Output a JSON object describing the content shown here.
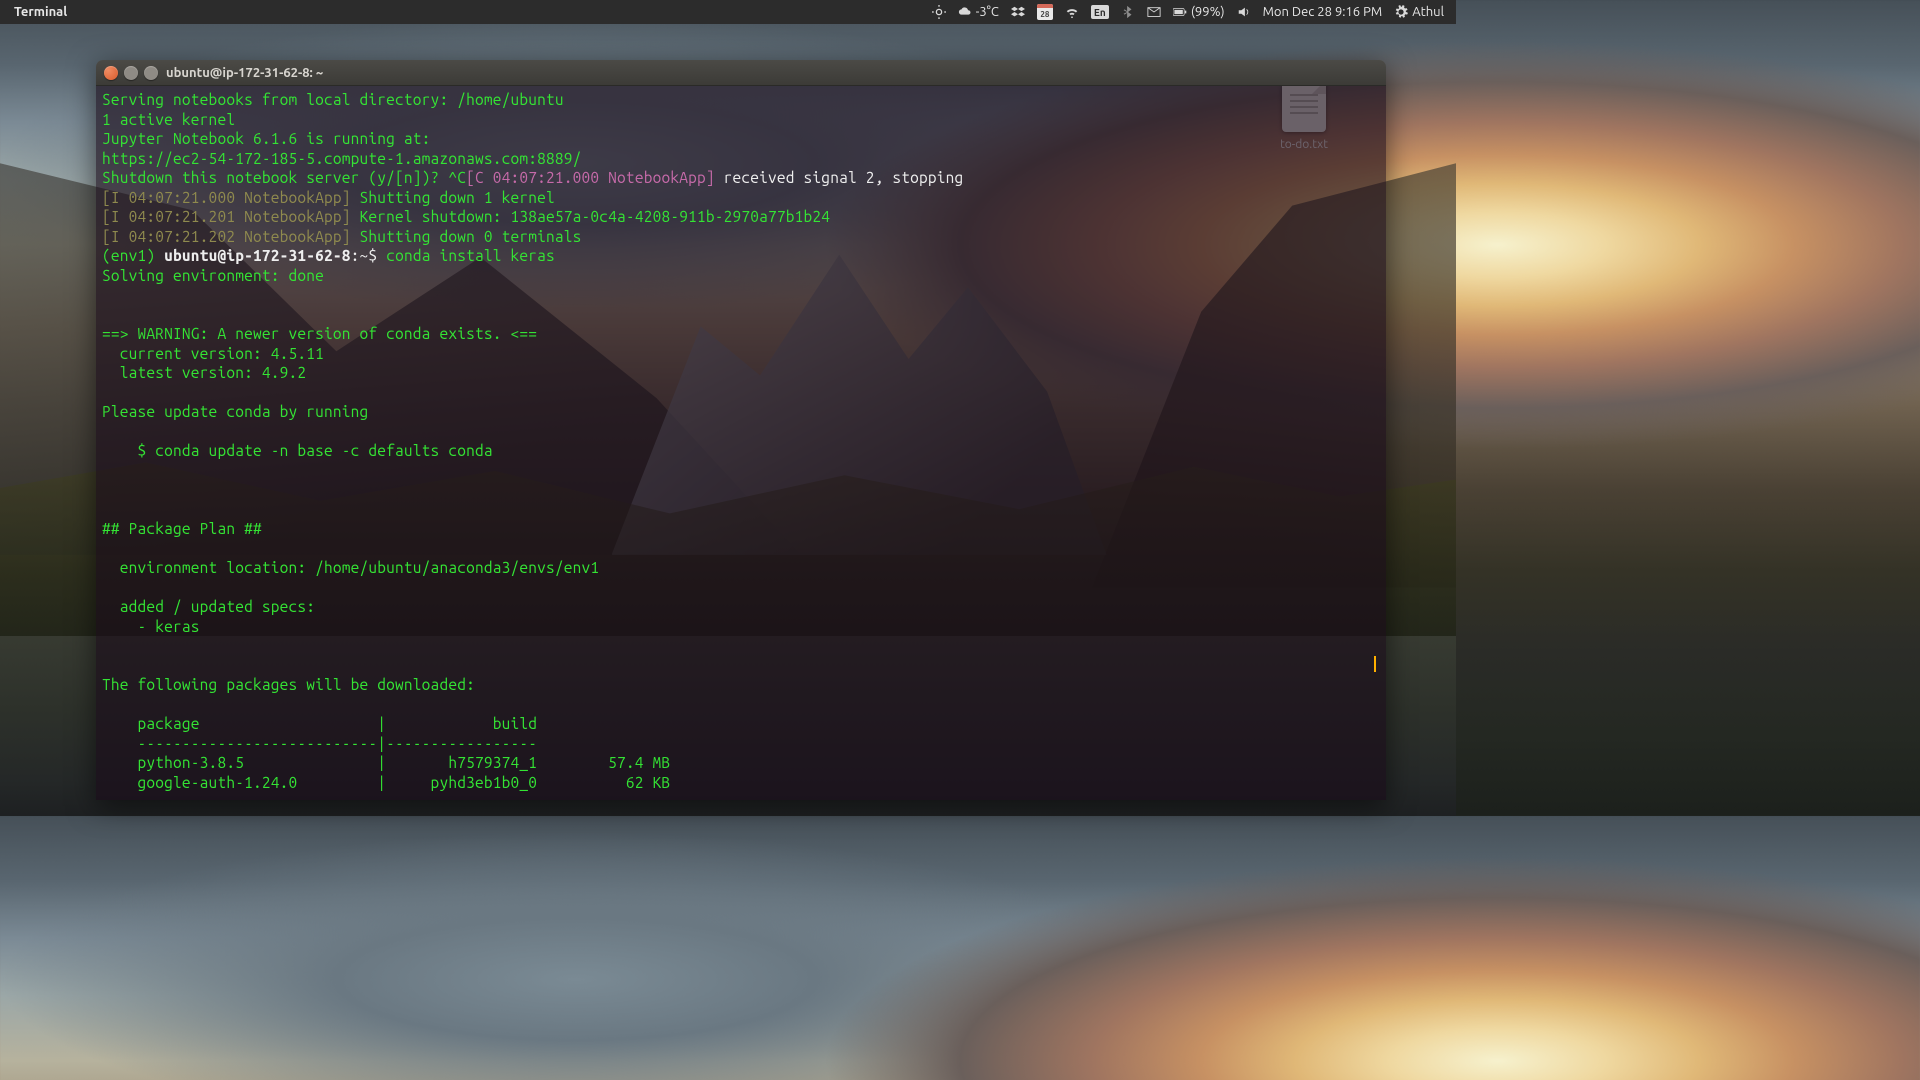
{
  "panel": {
    "app_label": "Terminal",
    "temp": "-3°C",
    "calendar_day": "28",
    "input_indicator": "En",
    "battery": "(99%)",
    "datetime": "Mon Dec 28  9:16 PM",
    "user": "Athul"
  },
  "desktop": {
    "file_label": "to-do.txt"
  },
  "window": {
    "title": "ubuntu@ip-172-31-62-8: ~"
  },
  "term": {
    "l1": "Serving notebooks from local directory: /home/ubuntu",
    "l2": "1 active kernel",
    "l3": "Jupyter Notebook 6.1.6 is running at:",
    "l4": "https://ec2-54-172-185-5.compute-1.amazonaws.com:8889/",
    "l5a": "Shutdown this notebook server (y/[n])? ^C",
    "l5b": "[C 04:07:21.000 NotebookApp]",
    "l5c": " received signal 2, stopping",
    "l6a": "[I 04:07:21.000 NotebookApp]",
    "l6b": " Shutting down 1 kernel",
    "l7a": "[I 04:07:21.201 NotebookApp]",
    "l7b": " Kernel shutdown: 138ae57a-0c4a-4208-911b-2970a77b1b24",
    "l8a": "[I 04:07:21.202 NotebookApp]",
    "l8b": " Shutting down 0 terminals",
    "prompt_env": "(env1) ",
    "prompt_userhost": "ubuntu@ip-172-31-62-8",
    "prompt_path": ":~$ ",
    "cmd": "conda install keras",
    "l10": "Solving environment: done",
    "l11": "",
    "l12": "",
    "l13": "==> WARNING: A newer version of conda exists. <==",
    "l14": "  current version: 4.5.11",
    "l15": "  latest version: 4.9.2",
    "l16": "",
    "l17": "Please update conda by running",
    "l18": "",
    "l19": "    $ conda update -n base -c defaults conda",
    "l20": "",
    "l21": "",
    "l22": "",
    "l23": "## Package Plan ##",
    "l24": "",
    "l25": "  environment location: /home/ubuntu/anaconda3/envs/env1",
    "l26": "",
    "l27": "  added / updated specs:",
    "l28": "    - keras",
    "l29": "",
    "l30": "",
    "l31": "The following packages will be downloaded:",
    "l32": "",
    "l33": "    package                    |            build",
    "l34": "    ---------------------------|-----------------",
    "l35": "    python-3.8.5               |       h7579374_1        57.4 MB",
    "l36": "    google-auth-1.24.0         |     pyhd3eb1b0_0          62 KB"
  }
}
